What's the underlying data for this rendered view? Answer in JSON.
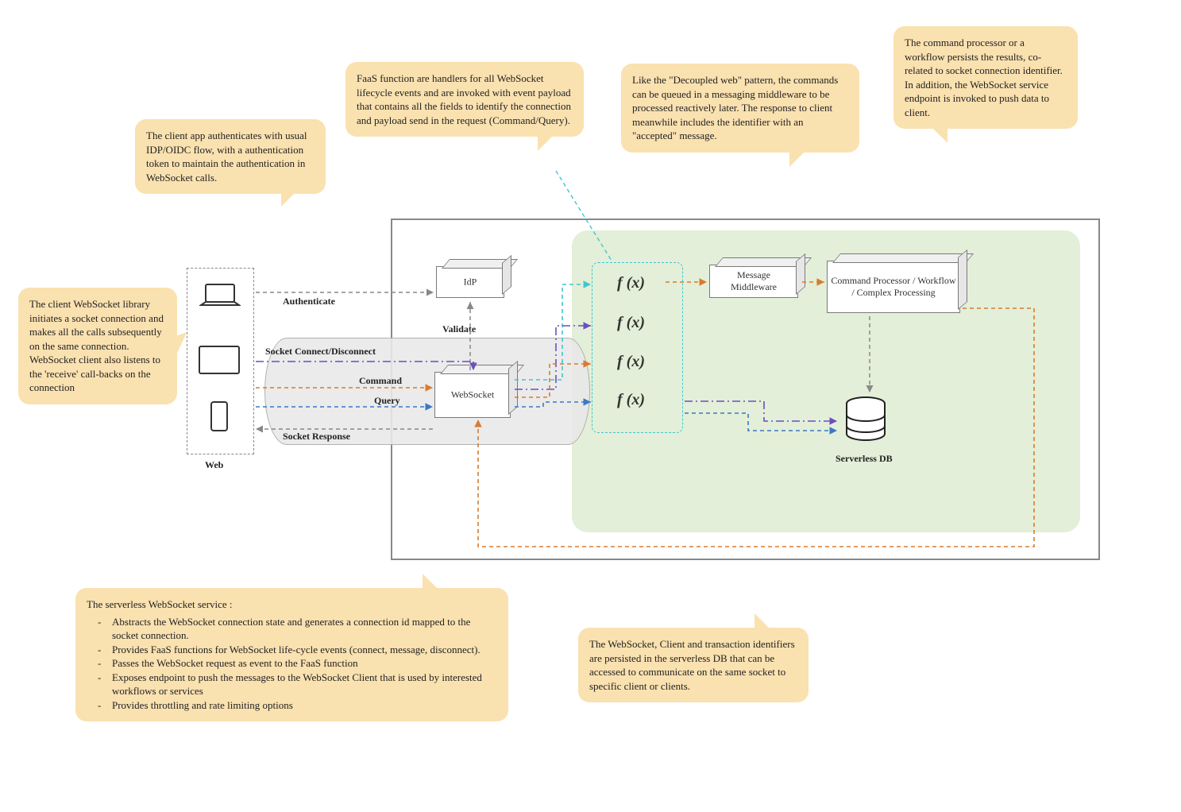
{
  "callouts": {
    "auth": "The client app authenticates with usual IDP/OIDC flow, with a authentication token to maintain the authentication in WebSocket calls.",
    "wsClient": "The client WebSocket library initiates a socket connection and makes all the calls subsequently on the same connection. WebSocket client also listens to the 'receive' call-backs on the connection",
    "faas": "FaaS function are handlers for all WebSocket lifecycle events and are invoked with event payload that contains all the fields to identify the connection and payload send in the request (Command/Query).",
    "decoupled": "Like the \"Decoupled web\" pattern, the commands can be queued in a messaging middleware to be processed reactively later. The response to client meanwhile includes the identifier with an \"accepted\" message.",
    "commandProc": "The command processor or a workflow persists the results, co-related to socket connection identifier. In addition, the WebSocket service endpoint is invoked to push data to client.",
    "wsService": {
      "heading": "The serverless WebSocket service :",
      "bullets": [
        "Abstracts the WebSocket connection state and generates a connection id mapped to the socket connection.",
        "Provides FaaS functions for WebSocket life-cycle events (connect, message, disconnect).",
        "Passes the WebSocket request as event to the FaaS function",
        "Exposes endpoint to push the messages to the WebSocket Client that is used by interested workflows or services",
        "Provides throttling and rate limiting options"
      ]
    },
    "dbNote": "The WebSocket, Client and transaction identifiers are persisted in the serverless DB that can be accessed to communicate on the same socket to specific client or clients."
  },
  "labels": {
    "web": "Web",
    "authenticate": "Authenticate",
    "socketConnect": "Socket Connect/Disconnect",
    "command": "Command",
    "query": "Query",
    "socketResponse": "Socket Response",
    "validate": "Validate",
    "serverlessDb": "Serverless DB"
  },
  "nodes": {
    "idp": "IdP",
    "websocket": "WebSocket",
    "msgMw": "Message Middleware",
    "cmdProc": "Command Processor / Workflow / Complex Processing"
  },
  "fx": [
    "f (x)",
    "f (x)",
    "f (x)",
    "f (x)"
  ],
  "colors": {
    "orange": "#d97b2e",
    "purple": "#6a4fbf",
    "teal": "#3fc6d0",
    "blue": "#3b78c7",
    "gray": "#888888"
  }
}
